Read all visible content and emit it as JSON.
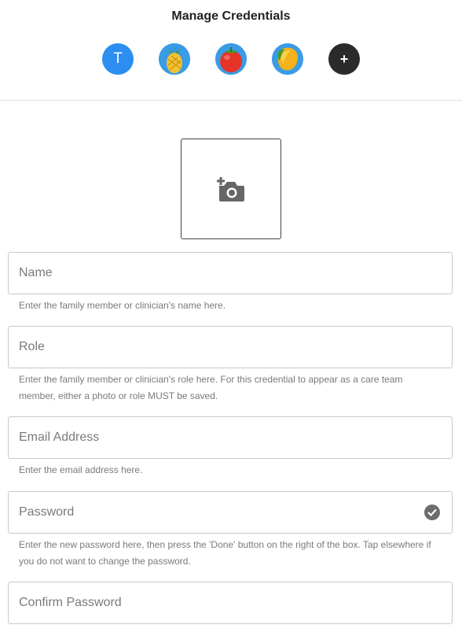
{
  "header": {
    "title": "Manage Credentials",
    "avatars": [
      {
        "type": "letter",
        "label": "T",
        "color": "#2b8ef0"
      },
      {
        "type": "image",
        "icon": "pineapple-icon"
      },
      {
        "type": "image",
        "icon": "tomato-icon"
      },
      {
        "type": "image",
        "icon": "mango-icon"
      },
      {
        "type": "add",
        "label": "+",
        "color": "#2b2b2b"
      }
    ]
  },
  "photo": {
    "icon": "add-photo-camera-icon"
  },
  "form": {
    "name": {
      "placeholder": "Name",
      "value": "",
      "help": "Enter the family member or clinician's name here."
    },
    "role": {
      "placeholder": "Role",
      "value": "",
      "help": "Enter the family member or clinician's role here. For this credential to appear as a care team member, either a photo or role MUST be saved."
    },
    "email": {
      "placeholder": "Email Address",
      "value": "",
      "help": "Enter the email address here."
    },
    "password": {
      "placeholder": "Password",
      "value": "",
      "help": "Enter the new password here, then press the 'Done' button on the right of the box. Tap elsewhere if you do not want to change the password.",
      "done_icon": "check-circle-icon"
    },
    "confirm_password": {
      "placeholder": "Confirm Password",
      "value": ""
    }
  },
  "colors": {
    "accent": "#2b8ef0",
    "help_text": "#7a7a7a",
    "border": "#c9c9c9"
  }
}
